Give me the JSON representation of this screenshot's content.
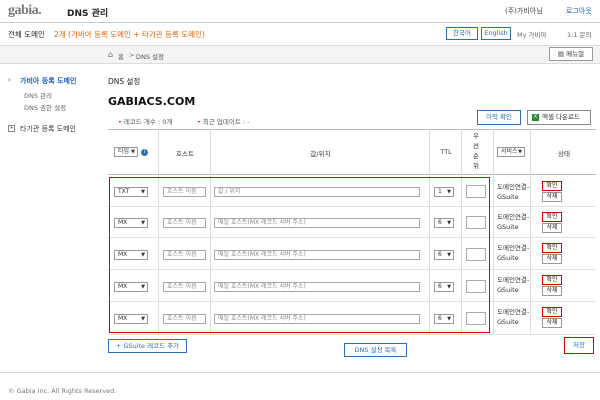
{
  "header": {
    "logo": "gabia.",
    "app_title": "DNS 관리",
    "user_name": "(주)가비아님",
    "logout": "로그아웃"
  },
  "domainbar": {
    "label": "전체 도메인",
    "count": "2개 (가비아 등록 도메인 + 타기관 등록 도메인)",
    "lang_ko": "한국어",
    "lang_en": "English",
    "my_gabia": "My 가비아",
    "inquiry": "1:1 문의"
  },
  "breadcrumb": {
    "home": "홈",
    "separator": ">",
    "current": "DNS 설정",
    "manual": "메뉴얼"
  },
  "sidebar": {
    "groups": [
      {
        "label": "가비아 등록 도메인",
        "items": [
          "DNS 관리",
          "DNS 권한 설정"
        ]
      },
      {
        "label": "타기관 등록 도메인",
        "items": []
      }
    ]
  },
  "main": {
    "title": "DNS 설정",
    "domain": "GABIACS.COM",
    "record_count": "레코드 개수 : 0개",
    "last_update": "최근 업데이트 : -",
    "history_button": "이력 확인",
    "excel_button": "엑셀 다운로드",
    "excel_icon": "X"
  },
  "table": {
    "headers": {
      "type": "타입",
      "host": "호스트",
      "value": "값/위치",
      "ttl": "TTL",
      "priority": "우선순위",
      "service": "서비스",
      "status": "상태"
    },
    "rows": [
      {
        "type": "TXT",
        "host": "호스트 이름",
        "value": "값 / 위치",
        "ttl": "1",
        "service": "도메인연결-GSuite",
        "confirm": "확인",
        "delete": "삭제"
      },
      {
        "type": "MX",
        "host": "호스트 이름",
        "value": "메일 호스트(MX 레코드 서버 주소)",
        "ttl": "6",
        "service": "도메인연결-GSuite",
        "confirm": "확인",
        "delete": "삭제"
      },
      {
        "type": "MX",
        "host": "호스트 이름",
        "value": "메일 호스트(MX 레코드 서버 주소)",
        "ttl": "6",
        "service": "도메인연결-GSuite",
        "confirm": "확인",
        "delete": "삭제"
      },
      {
        "type": "MX",
        "host": "호스트 이름",
        "value": "메일 호스트(MX 레코드 서버 주소)",
        "ttl": "6",
        "service": "도메인연결-GSuite",
        "confirm": "확인",
        "delete": "삭제"
      },
      {
        "type": "MX",
        "host": "호스트 이름",
        "value": "메일 호스트(MX 레코드 서버 주소)",
        "ttl": "6",
        "service": "도메인연결-GSuite",
        "confirm": "확인",
        "delete": "삭제"
      }
    ]
  },
  "actions": {
    "add_gsuite": "+ GSuite 레코드 추가",
    "dns_list": "DNS 설정 목록",
    "save": "저장"
  },
  "footer": {
    "copyright": "© Gabia Inc. All Rights Reserved."
  },
  "colors": {
    "accent_blue": "#2e6fb7",
    "highlight_red": "#dd0000",
    "warning_orange": "#e06000"
  }
}
